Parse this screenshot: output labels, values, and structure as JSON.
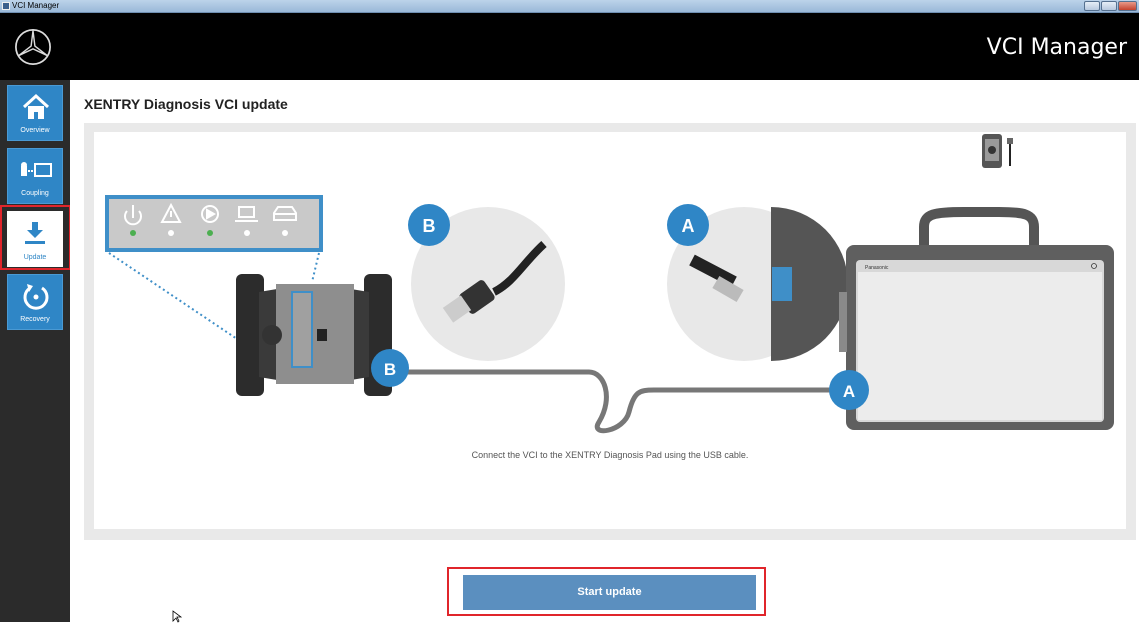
{
  "window": {
    "title": "VCI Manager"
  },
  "header": {
    "app_title": "VCI Manager",
    "logo_icon": "mercedes-star-icon"
  },
  "sidebar": {
    "items": [
      {
        "label": "Overview",
        "icon": "home-icon",
        "active": false
      },
      {
        "label": "Coupling",
        "icon": "coupling-icon",
        "active": false
      },
      {
        "label": "Update",
        "icon": "download-icon",
        "active": true
      },
      {
        "label": "Recovery",
        "icon": "recovery-icon",
        "active": false
      }
    ]
  },
  "main": {
    "title": "XENTRY Diagnosis VCI update",
    "illustration": {
      "caption": "Connect the VCI to the XENTRY Diagnosis Pad using the USB cable.",
      "badge_b": "B",
      "badge_a": "A",
      "tablet_brand": "Panasonic",
      "status_icons": [
        "power-icon",
        "warning-icon",
        "play-icon",
        "laptop-icon",
        "car-icon"
      ]
    },
    "start_button_label": "Start update"
  },
  "colors": {
    "accent": "#2f86c6",
    "button": "#5b8fbf",
    "highlight": "#e0252b",
    "header": "#000000",
    "sidebar": "#2b2b2b"
  }
}
